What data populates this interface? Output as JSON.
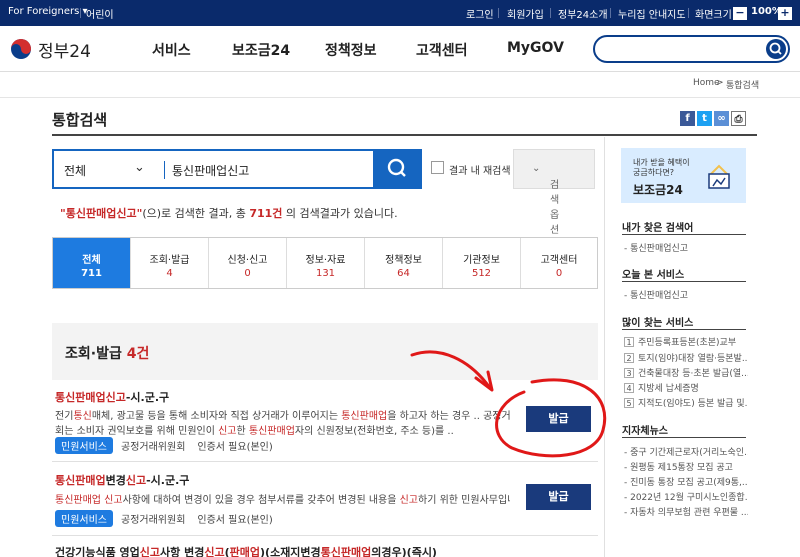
{
  "utilbar": {
    "foreigners": "For Foreigners",
    "kids": "어린이",
    "login": "로그인",
    "signup": "회원가입",
    "about": "정부24소개",
    "sitemap": "누리집 안내지도",
    "zoom_label": "화면크기",
    "zoom_minus": "−",
    "zoom_value": "100%",
    "zoom_plus": "+"
  },
  "header": {
    "logo": "정부24",
    "nav": [
      "서비스",
      "보조금24",
      "정책정보",
      "고객센터",
      "MyGOV"
    ]
  },
  "breadcrumb": {
    "home": "Home",
    "sep": ">",
    "current": "통합검색"
  },
  "page_title": "통합검색",
  "search": {
    "scope": "전체",
    "query": "통신판매업신고",
    "within_label": "결과 내 재검색",
    "options_label": "검색옵션"
  },
  "summary": {
    "open_quote": "\"",
    "keyword": "통신판매업신고",
    "close_quote": "\"",
    "pre": "(으)로 검색한 결과, 총 ",
    "total": "711건",
    "post": " 의 검색결과가 있습니다."
  },
  "tabs": [
    {
      "label": "전체",
      "count": "711"
    },
    {
      "label": "조회·발급",
      "count": "4"
    },
    {
      "label": "신청·신고",
      "count": "0"
    },
    {
      "label": "정보·자료",
      "count": "131"
    },
    {
      "label": "정책정보",
      "count": "64"
    },
    {
      "label": "기관정보",
      "count": "512"
    },
    {
      "label": "고객센터",
      "count": "0"
    }
  ],
  "section": {
    "title": "조회·발급",
    "count": "4건"
  },
  "results": [
    {
      "title_hl": "통신판매업신고",
      "title_rest": "-시.군.구",
      "desc1_a": "전기",
      "desc1_hl1": "통신",
      "desc1_b": "매체, 광고물 등을 통해 소비자와 직접 상거래가 이루어지는 ",
      "desc1_hl2": "통신판매업",
      "desc1_c": "을 하고자 하는 경우 .. 공정거래위원",
      "desc2_a": "회는 소비자 권익보호를 위해 민원인이 ",
      "desc2_hl1": "신고",
      "desc2_b": "한 ",
      "desc2_hl2": "통신판매업",
      "desc2_c": "자의 신원정보(전화번호, 주소 등)를 ..",
      "badge": "민원서비스",
      "agency": "공정거래위원회",
      "cert": "인증서 필요(본인)",
      "button": "발급"
    },
    {
      "title_hl": "통신판매업",
      "title_mid": "변경",
      "title_hl2": "신고",
      "title_rest": "-시.군.구",
      "desc1_hl1": "통신판매업 신고",
      "desc1_b": "사항에 대하여 변경이 있을 경우 첨부서류를 갖추어 변경된 내용을 ",
      "desc1_hl2": "신고",
      "desc1_c": "하기 위한 민원사무입니다.",
      "badge": "민원서비스",
      "agency": "공정거래위원회",
      "cert": "인증서 필요(본인)",
      "button": "발급"
    },
    {
      "title_a": "건강기능식품 영업",
      "title_hl1": "신고",
      "title_b": "사항 변경",
      "title_hl2": "신고",
      "title_c": "(",
      "title_hl3": "판매업",
      "title_d": ")(소재지변경",
      "title_hl4": "통신판매업",
      "title_e": "의경우)(즉시)"
    }
  ],
  "sidebar": {
    "banner_line1": "내가 받을 혜택이",
    "banner_line2": "궁금하다면?",
    "banner_title": "보조금24",
    "my_search_title": "내가 찾은 검색어",
    "my_search_items": [
      "통신판매업신고"
    ],
    "today_title": "오늘 본 서비스",
    "today_items": [
      "통신판매업신고"
    ],
    "popular_title": "많이 찾는 서비스",
    "popular_items": [
      {
        "n": "1",
        "t": "주민등록표등본(초본)교부"
      },
      {
        "n": "2",
        "t": "토지(임야)대장 열람·등본발..."
      },
      {
        "n": "3",
        "t": "건축물대장 등·초본 발급(열..."
      },
      {
        "n": "4",
        "t": "지방세 납세증명"
      },
      {
        "n": "5",
        "t": "지적도(임야도) 등본 발급 및..."
      }
    ],
    "news_title": "지자체뉴스",
    "news_items": [
      "중구 기간제근로자(거리노숙인...",
      "원평동 제15통장 모집 공고",
      "진미동 통장 모집 공고(제9통,...",
      "2022년 12월 구미시노인종합...",
      "자동차 의무보험 관련 우편물 ..."
    ]
  },
  "colors": {
    "navy": "#0a2a6b",
    "primary": "#1565c0",
    "tab_active": "#1e7be0",
    "highlight": "#c62828",
    "button": "#1a3a7c"
  }
}
